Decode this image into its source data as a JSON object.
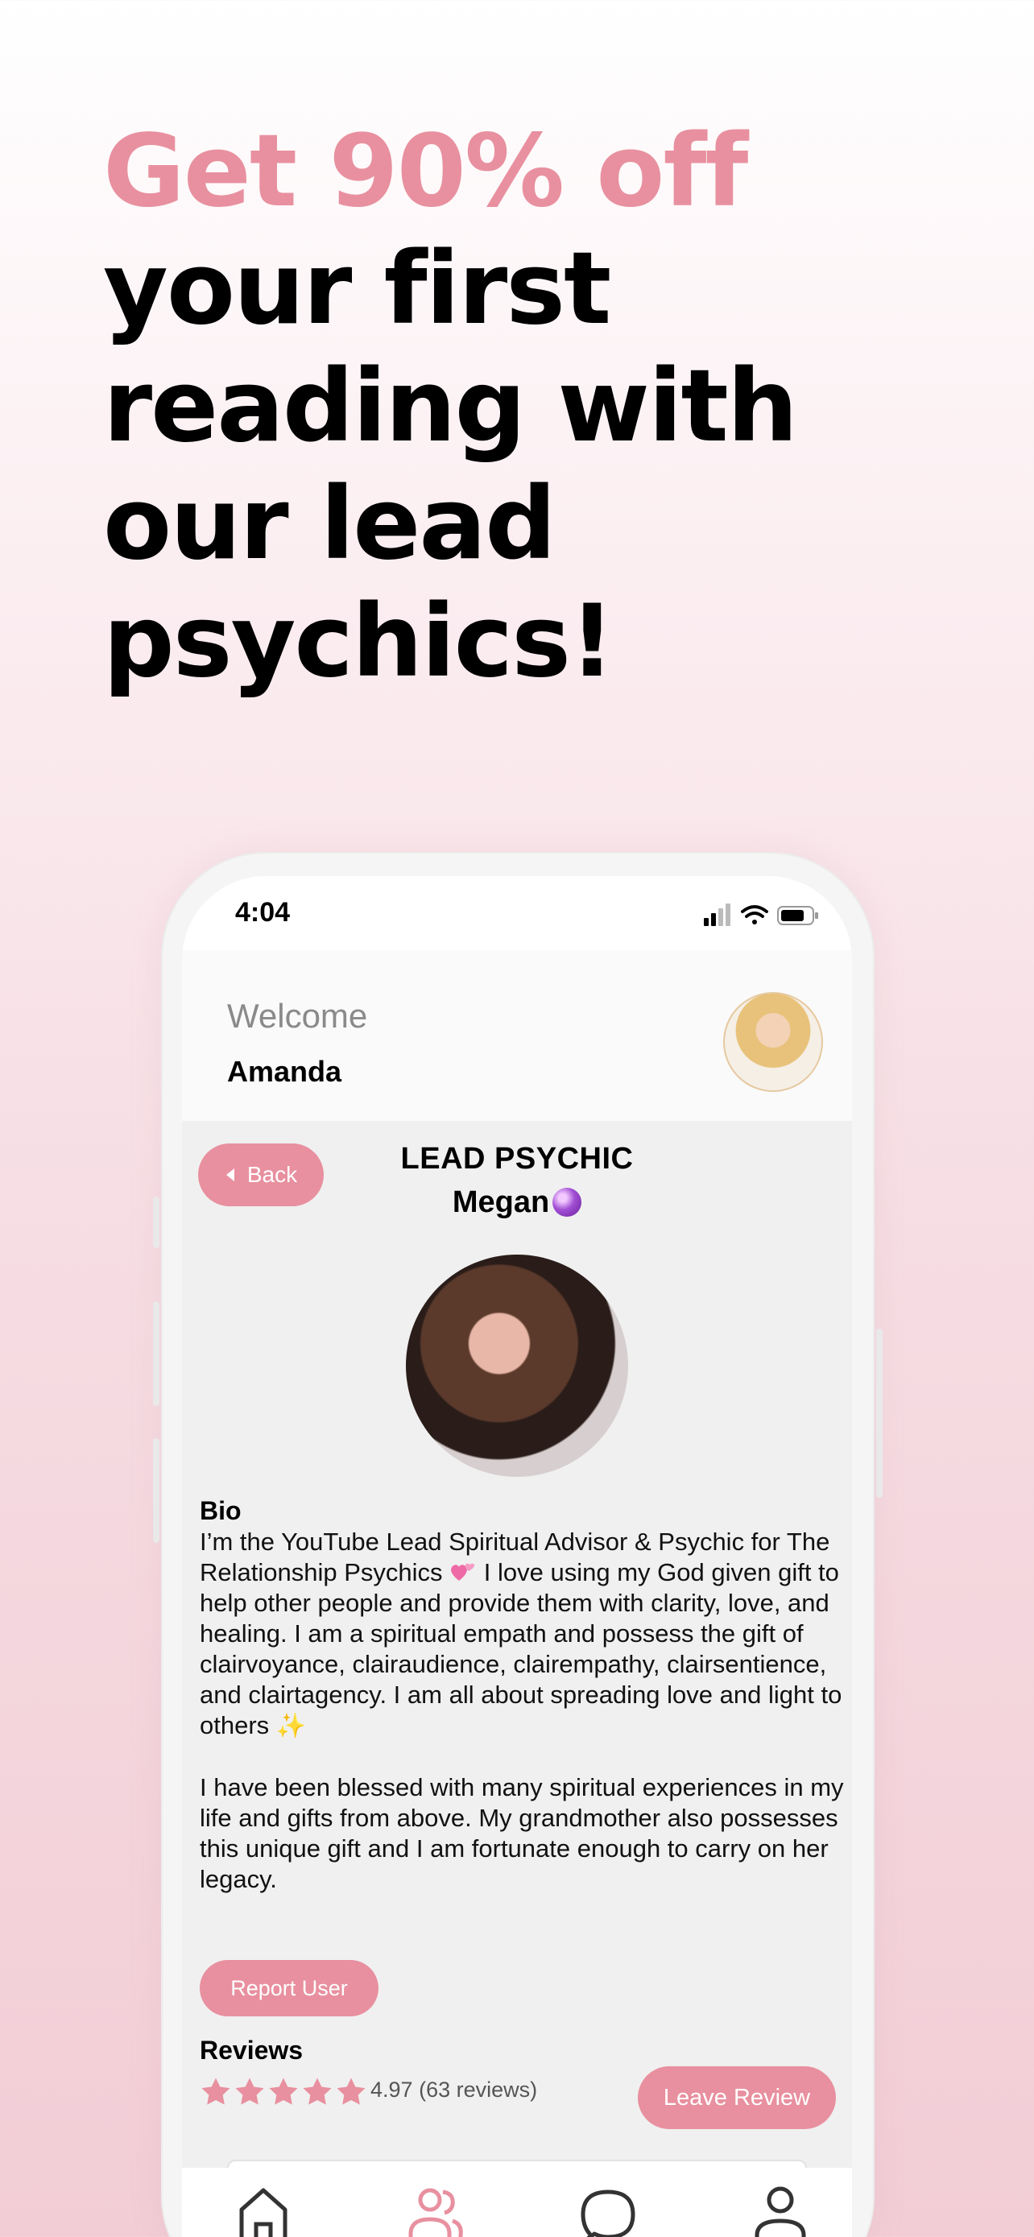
{
  "headline": {
    "line1": "Get 90% off",
    "line2": "your first",
    "line3": "reading with",
    "line4": "our lead",
    "line5": "psychics!",
    "accent_color": "#e8909f"
  },
  "status_bar": {
    "time": "4:04"
  },
  "header": {
    "welcome": "Welcome",
    "user_name": "Amanda"
  },
  "profile": {
    "back_label": "Back",
    "title": "LEAD PSYCHIC",
    "name": "Megan",
    "name_icon": "crystal-ball-icon",
    "bio_heading": "Bio",
    "bio_p1_a": "I’m the YouTube Lead Spiritual Advisor & Psychic for The Relationship Psychics",
    "bio_p1_b": "I love using my God given gift to help other people and provide them with clarity, love, and healing. I am a spiritual empath and possess the gift of clairvoyance, clairaudience, clairempathy, clairsentience, and clairtagency. I am all about spreading love and light to others",
    "bio_p2": "I have been blessed with many spiritual experiences in my life and gifts from above. My grandmother also possesses this unique gift and I am fortunate enough to carry on her legacy.",
    "report_label": "Report User"
  },
  "reviews": {
    "heading": "Reviews",
    "rating": "4.97",
    "count_text": "(63 reviews)",
    "stars": 5,
    "leave_label": "Leave Review"
  },
  "tab_bar": {
    "items": [
      "home-icon",
      "users-icon",
      "chat-icon",
      "profile-icon"
    ],
    "active": "users-icon"
  }
}
